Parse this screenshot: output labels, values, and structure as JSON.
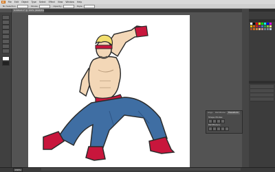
{
  "app": {
    "logo": "Ai"
  },
  "menubar": {
    "items": [
      "File",
      "Edit",
      "Object",
      "Type",
      "Select",
      "Effect",
      "View",
      "Window",
      "Help"
    ]
  },
  "options_bar": {
    "no_selection_label": "No Selection",
    "stroke_label": "Stroke:",
    "opacity_label": "Opacity:",
    "style_label": "Style:"
  },
  "document": {
    "tab_title": "Untitled-1* @ 150% (RGB/Preview)"
  },
  "status": {
    "zoom": "150%"
  },
  "floating_panel": {
    "tabs": [
      "Align",
      "Pathfinder",
      "Transform"
    ],
    "active_tab": "Transform",
    "row1_label": "Shape Modes:",
    "row2_label": "Pathfinders:"
  },
  "colors": {
    "skin": "#f3d7b7",
    "red_accent": "#c8163c",
    "pants": "#3f6ea3",
    "hair": "#f2de6e"
  },
  "icons": [
    "selection-tool-icon",
    "direct-selection-icon",
    "pen-tool-icon",
    "type-tool-icon",
    "brush-tool-icon",
    "shape-tool-icon",
    "zoom-tool-icon",
    "hand-tool-icon"
  ]
}
